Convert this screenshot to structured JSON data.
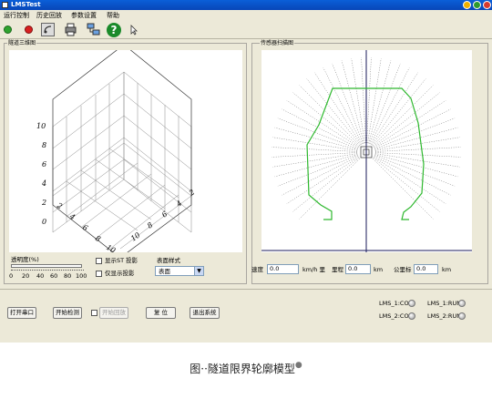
{
  "window": {
    "title": "LMSTest"
  },
  "menu": [
    "运行控制",
    "历史回放",
    "参数设置",
    "帮助"
  ],
  "toolbar": {
    "icons": [
      "start-icon",
      "stop-icon",
      "scanner-icon",
      "print-icon",
      "network-icon",
      "help-icon",
      "pointer-icon"
    ]
  },
  "left_panel": {
    "title": "隧道三维图",
    "z_ticks": [
      "10",
      "8",
      "6",
      "4",
      "2",
      "0"
    ],
    "x_ticks": [
      "2",
      "4",
      "6",
      "8",
      "10"
    ],
    "y_ticks": [
      "2",
      "4",
      "6",
      "8",
      "10"
    ],
    "transparency_label": "透明度(%)",
    "transparency_ticks": [
      "0",
      "20",
      "40",
      "60",
      "80",
      "100"
    ],
    "transparency_value": 0,
    "show_st_label": "显示ST 投影",
    "proj_only_label": "仅显示投影",
    "style_label": "表面样式",
    "style_value": "表面"
  },
  "right_panel": {
    "title": "传感器扫描图"
  },
  "readouts": {
    "speed_label": "速度",
    "speed_value": "0.0",
    "speed_unit": "km/h 里",
    "mileage_label": "里程",
    "mileage_value": "0.0",
    "mileage_unit": "km",
    "marker_label": "公里标",
    "marker_value": "0.0",
    "marker_unit": "km"
  },
  "controls": {
    "open_port": "打开串口",
    "start_detect": "开始检测",
    "start_replay": "开始回放",
    "reset": "复 位",
    "exit": "退出系统"
  },
  "status": {
    "lms1_com": "LMS_1:COM",
    "lms2_com": "LMS_2:COM",
    "lms1_run": "LMS_1:RUN",
    "lms2_run": "LMS_2:RUN"
  },
  "caption": "图··隧道限界轮廓模型"
}
